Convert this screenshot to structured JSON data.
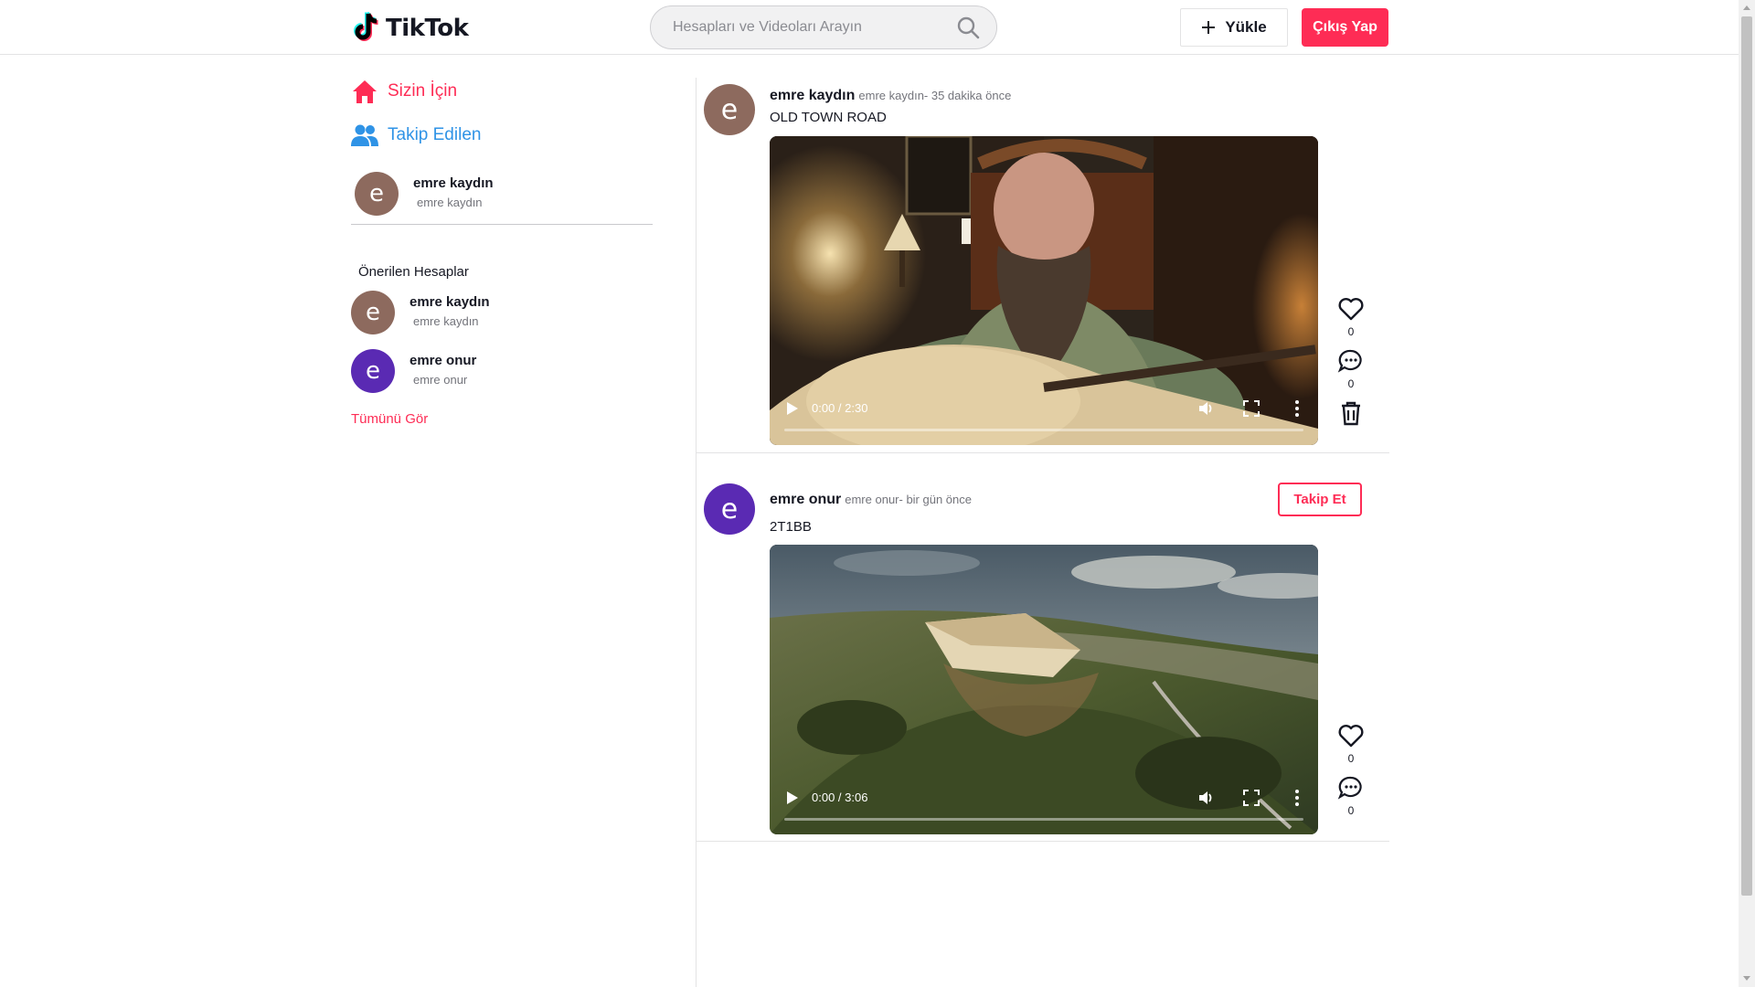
{
  "header": {
    "logo_text": "TikTok",
    "search_placeholder": "Hesapları ve Videoları Arayın",
    "upload_label": "Yükle",
    "logout_label": "Çıkış Yap"
  },
  "sidebar": {
    "nav": [
      {
        "label": "Sizin İçin",
        "icon": "home-icon",
        "color": "#fe2c55"
      },
      {
        "label": "Takip Edilen",
        "icon": "users-icon",
        "color": "#2f93e6"
      }
    ],
    "current_user": {
      "initial": "e",
      "name": "emre kaydın",
      "handle": "emre kaydın",
      "avatar_color": "#8d6a5e"
    },
    "suggested_title": "Önerilen Hesaplar",
    "suggested": [
      {
        "initial": "e",
        "name": "emre kaydın",
        "handle": "emre kaydın",
        "avatar_color": "#8d6a5e"
      },
      {
        "initial": "e",
        "name": "emre onur",
        "handle": "emre onur",
        "avatar_color": "#5a2ab3"
      }
    ],
    "see_all": "Tümünü Gör"
  },
  "posts": [
    {
      "initial": "e",
      "avatar_color": "#8d6a5e",
      "author": "emre kaydın",
      "meta": "emre kaydın- 35 dakika önce",
      "caption": "OLD TOWN ROAD",
      "time": "0:00 / 2:30",
      "likes": "0",
      "comments": "0",
      "has_delete": true
    },
    {
      "initial": "e",
      "avatar_color": "#5a2ab3",
      "author": "emre onur",
      "meta": "emre onur- bir gün önce",
      "caption": "2T1BB",
      "time": "0:00 / 3:06",
      "likes": "0",
      "comments": "0",
      "follow_label": "Takip Et"
    }
  ],
  "colors": {
    "accent": "#fe2c55",
    "link_blue": "#2f93e6"
  }
}
